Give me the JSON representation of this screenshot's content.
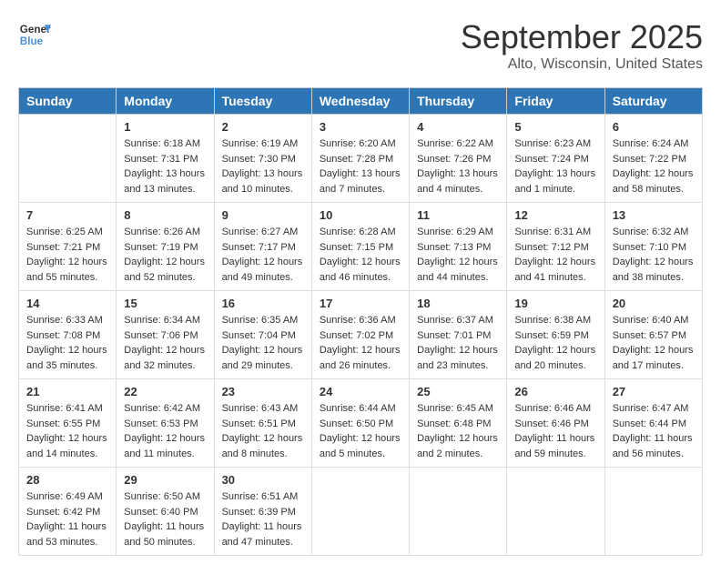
{
  "logo": {
    "line1": "General",
    "line2": "Blue"
  },
  "title": "September 2025",
  "location": "Alto, Wisconsin, United States",
  "headers": [
    "Sunday",
    "Monday",
    "Tuesday",
    "Wednesday",
    "Thursday",
    "Friday",
    "Saturday"
  ],
  "weeks": [
    [
      {
        "day": "",
        "sunrise": "",
        "sunset": "",
        "daylight": ""
      },
      {
        "day": "1",
        "sunrise": "Sunrise: 6:18 AM",
        "sunset": "Sunset: 7:31 PM",
        "daylight": "Daylight: 13 hours and 13 minutes."
      },
      {
        "day": "2",
        "sunrise": "Sunrise: 6:19 AM",
        "sunset": "Sunset: 7:30 PM",
        "daylight": "Daylight: 13 hours and 10 minutes."
      },
      {
        "day": "3",
        "sunrise": "Sunrise: 6:20 AM",
        "sunset": "Sunset: 7:28 PM",
        "daylight": "Daylight: 13 hours and 7 minutes."
      },
      {
        "day": "4",
        "sunrise": "Sunrise: 6:22 AM",
        "sunset": "Sunset: 7:26 PM",
        "daylight": "Daylight: 13 hours and 4 minutes."
      },
      {
        "day": "5",
        "sunrise": "Sunrise: 6:23 AM",
        "sunset": "Sunset: 7:24 PM",
        "daylight": "Daylight: 13 hours and 1 minute."
      },
      {
        "day": "6",
        "sunrise": "Sunrise: 6:24 AM",
        "sunset": "Sunset: 7:22 PM",
        "daylight": "Daylight: 12 hours and 58 minutes."
      }
    ],
    [
      {
        "day": "7",
        "sunrise": "Sunrise: 6:25 AM",
        "sunset": "Sunset: 7:21 PM",
        "daylight": "Daylight: 12 hours and 55 minutes."
      },
      {
        "day": "8",
        "sunrise": "Sunrise: 6:26 AM",
        "sunset": "Sunset: 7:19 PM",
        "daylight": "Daylight: 12 hours and 52 minutes."
      },
      {
        "day": "9",
        "sunrise": "Sunrise: 6:27 AM",
        "sunset": "Sunset: 7:17 PM",
        "daylight": "Daylight: 12 hours and 49 minutes."
      },
      {
        "day": "10",
        "sunrise": "Sunrise: 6:28 AM",
        "sunset": "Sunset: 7:15 PM",
        "daylight": "Daylight: 12 hours and 46 minutes."
      },
      {
        "day": "11",
        "sunrise": "Sunrise: 6:29 AM",
        "sunset": "Sunset: 7:13 PM",
        "daylight": "Daylight: 12 hours and 44 minutes."
      },
      {
        "day": "12",
        "sunrise": "Sunrise: 6:31 AM",
        "sunset": "Sunset: 7:12 PM",
        "daylight": "Daylight: 12 hours and 41 minutes."
      },
      {
        "day": "13",
        "sunrise": "Sunrise: 6:32 AM",
        "sunset": "Sunset: 7:10 PM",
        "daylight": "Daylight: 12 hours and 38 minutes."
      }
    ],
    [
      {
        "day": "14",
        "sunrise": "Sunrise: 6:33 AM",
        "sunset": "Sunset: 7:08 PM",
        "daylight": "Daylight: 12 hours and 35 minutes."
      },
      {
        "day": "15",
        "sunrise": "Sunrise: 6:34 AM",
        "sunset": "Sunset: 7:06 PM",
        "daylight": "Daylight: 12 hours and 32 minutes."
      },
      {
        "day": "16",
        "sunrise": "Sunrise: 6:35 AM",
        "sunset": "Sunset: 7:04 PM",
        "daylight": "Daylight: 12 hours and 29 minutes."
      },
      {
        "day": "17",
        "sunrise": "Sunrise: 6:36 AM",
        "sunset": "Sunset: 7:02 PM",
        "daylight": "Daylight: 12 hours and 26 minutes."
      },
      {
        "day": "18",
        "sunrise": "Sunrise: 6:37 AM",
        "sunset": "Sunset: 7:01 PM",
        "daylight": "Daylight: 12 hours and 23 minutes."
      },
      {
        "day": "19",
        "sunrise": "Sunrise: 6:38 AM",
        "sunset": "Sunset: 6:59 PM",
        "daylight": "Daylight: 12 hours and 20 minutes."
      },
      {
        "day": "20",
        "sunrise": "Sunrise: 6:40 AM",
        "sunset": "Sunset: 6:57 PM",
        "daylight": "Daylight: 12 hours and 17 minutes."
      }
    ],
    [
      {
        "day": "21",
        "sunrise": "Sunrise: 6:41 AM",
        "sunset": "Sunset: 6:55 PM",
        "daylight": "Daylight: 12 hours and 14 minutes."
      },
      {
        "day": "22",
        "sunrise": "Sunrise: 6:42 AM",
        "sunset": "Sunset: 6:53 PM",
        "daylight": "Daylight: 12 hours and 11 minutes."
      },
      {
        "day": "23",
        "sunrise": "Sunrise: 6:43 AM",
        "sunset": "Sunset: 6:51 PM",
        "daylight": "Daylight: 12 hours and 8 minutes."
      },
      {
        "day": "24",
        "sunrise": "Sunrise: 6:44 AM",
        "sunset": "Sunset: 6:50 PM",
        "daylight": "Daylight: 12 hours and 5 minutes."
      },
      {
        "day": "25",
        "sunrise": "Sunrise: 6:45 AM",
        "sunset": "Sunset: 6:48 PM",
        "daylight": "Daylight: 12 hours and 2 minutes."
      },
      {
        "day": "26",
        "sunrise": "Sunrise: 6:46 AM",
        "sunset": "Sunset: 6:46 PM",
        "daylight": "Daylight: 11 hours and 59 minutes."
      },
      {
        "day": "27",
        "sunrise": "Sunrise: 6:47 AM",
        "sunset": "Sunset: 6:44 PM",
        "daylight": "Daylight: 11 hours and 56 minutes."
      }
    ],
    [
      {
        "day": "28",
        "sunrise": "Sunrise: 6:49 AM",
        "sunset": "Sunset: 6:42 PM",
        "daylight": "Daylight: 11 hours and 53 minutes."
      },
      {
        "day": "29",
        "sunrise": "Sunrise: 6:50 AM",
        "sunset": "Sunset: 6:40 PM",
        "daylight": "Daylight: 11 hours and 50 minutes."
      },
      {
        "day": "30",
        "sunrise": "Sunrise: 6:51 AM",
        "sunset": "Sunset: 6:39 PM",
        "daylight": "Daylight: 11 hours and 47 minutes."
      },
      {
        "day": "",
        "sunrise": "",
        "sunset": "",
        "daylight": ""
      },
      {
        "day": "",
        "sunrise": "",
        "sunset": "",
        "daylight": ""
      },
      {
        "day": "",
        "sunrise": "",
        "sunset": "",
        "daylight": ""
      },
      {
        "day": "",
        "sunrise": "",
        "sunset": "",
        "daylight": ""
      }
    ]
  ]
}
